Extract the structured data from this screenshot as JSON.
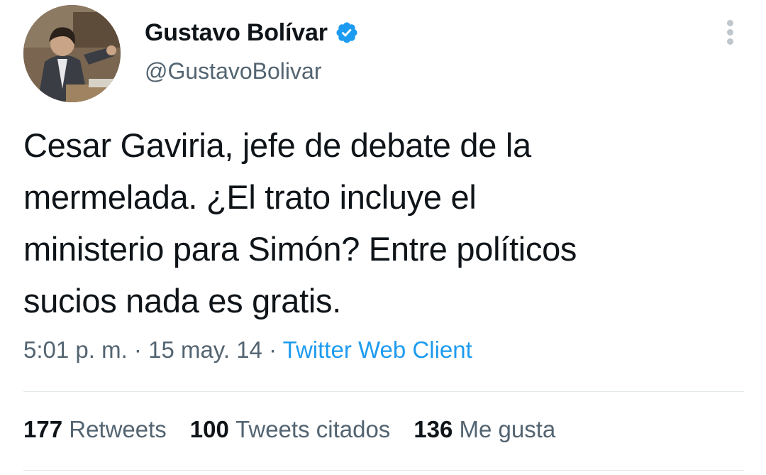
{
  "author": {
    "display_name": "Gustavo Bolívar",
    "handle": "@GustavoBolivar",
    "verified": true
  },
  "tweet": {
    "text_lines": [
      "Cesar Gaviria, jefe de debate de la",
      "mermelada. ¿El trato incluye el",
      "ministerio para Simón? Entre políticos",
      "sucios nada es gratis."
    ],
    "time": "5:01 p. m.",
    "date": "15 may. 14",
    "separator": "·",
    "client": "Twitter Web Client"
  },
  "stats": {
    "retweets_count": "177",
    "retweets_label": "Retweets",
    "quotes_count": "100",
    "quotes_label": "Tweets citados",
    "likes_count": "136",
    "likes_label": "Me gusta"
  },
  "icons": {
    "verified": "verified-badge-icon",
    "more": "more-options-icon"
  },
  "colors": {
    "text": "#0f1419",
    "secondary": "#536471",
    "link": "#1d9bf0",
    "divider": "#e3e8eb"
  }
}
